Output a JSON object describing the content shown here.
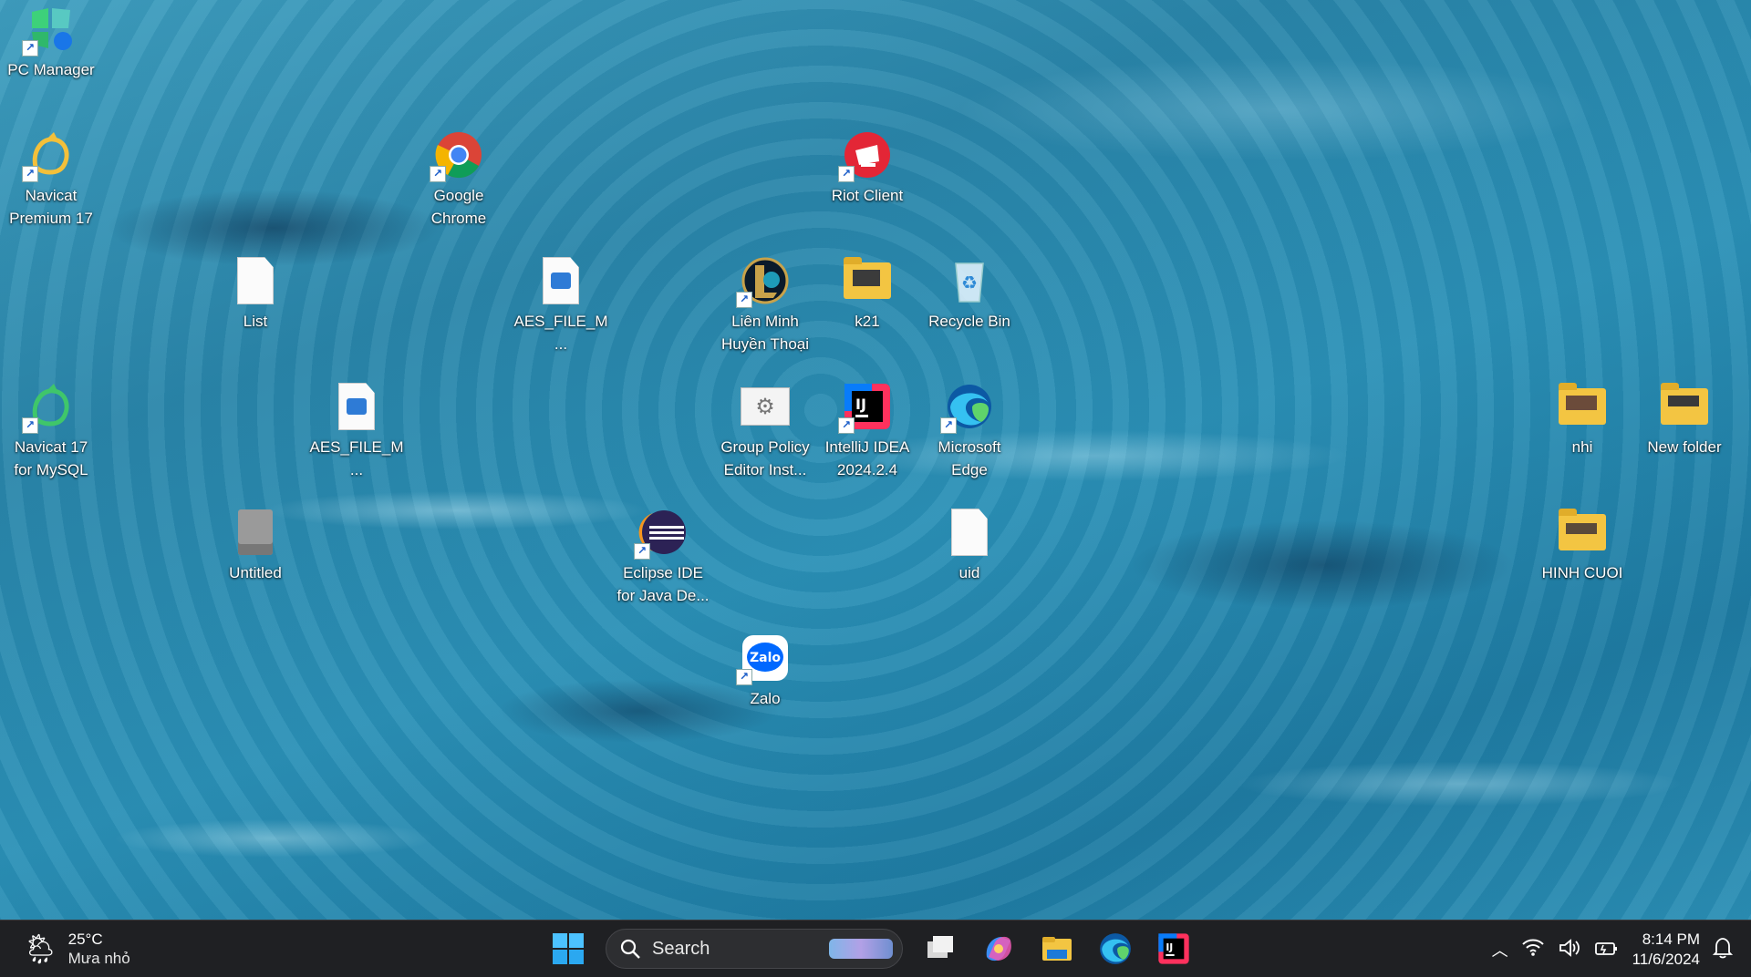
{
  "desktop": {
    "icons": [
      {
        "label": "PC Manager",
        "icon": "pc-manager-icon",
        "shortcut": true
      },
      {
        "label": "Navicat Premium 17",
        "icon": "navicat-premium-icon",
        "shortcut": true
      },
      {
        "label": "Google Chrome",
        "icon": "chrome-icon",
        "shortcut": true
      },
      {
        "label": "Riot Client",
        "icon": "riot-client-icon",
        "shortcut": true
      },
      {
        "label": "List",
        "icon": "text-document-icon",
        "shortcut": false
      },
      {
        "label": "AES_FILE_M...",
        "icon": "image-file-icon",
        "shortcut": false
      },
      {
        "label": "Liên Minh Huyền Thoại",
        "icon": "league-of-legends-icon",
        "shortcut": true
      },
      {
        "label": "k21",
        "icon": "folder-icon",
        "shortcut": false
      },
      {
        "label": "Recycle Bin",
        "icon": "recycle-bin-icon",
        "shortcut": false
      },
      {
        "label": "Navicat 17 for MySQL",
        "icon": "navicat-mysql-icon",
        "shortcut": true
      },
      {
        "label": "AES_FILE_M...",
        "icon": "image-file-icon",
        "shortcut": false
      },
      {
        "label": "Group Policy Editor Inst...",
        "icon": "settings-file-icon",
        "shortcut": false
      },
      {
        "label": "IntelliJ IDEA 2024.2.4",
        "icon": "intellij-idea-icon",
        "shortcut": true
      },
      {
        "label": "Microsoft Edge",
        "icon": "edge-icon",
        "shortcut": true
      },
      {
        "label": "nhi",
        "icon": "folder-icon",
        "shortcut": false
      },
      {
        "label": "New folder",
        "icon": "folder-icon",
        "shortcut": false
      },
      {
        "label": "Untitled",
        "icon": "archive-file-icon",
        "shortcut": false
      },
      {
        "label": "Eclipse IDE for Java De...",
        "icon": "eclipse-icon",
        "shortcut": true
      },
      {
        "label": "uid",
        "icon": "blank-file-icon",
        "shortcut": false
      },
      {
        "label": "HINH CUOI",
        "icon": "folder-icon",
        "shortcut": false
      },
      {
        "label": "Zalo",
        "icon": "zalo-icon",
        "shortcut": true
      }
    ]
  },
  "taskbar": {
    "weather": {
      "temp": "25°C",
      "condition": "Mưa nhỏ",
      "icon": "weather-rain-icon"
    },
    "search": {
      "placeholder": "Search"
    },
    "pinned": [
      "start-icon",
      "task-view-icon",
      "copilot-icon",
      "file-explorer-icon",
      "edge-icon",
      "intellij-idea-icon"
    ],
    "clock": {
      "time": "8:14 PM",
      "date": "11/6/2024"
    }
  },
  "colors": {
    "taskbar_bg": "#1f2023",
    "water": "#2a86aa",
    "folder": "#f3c542"
  }
}
